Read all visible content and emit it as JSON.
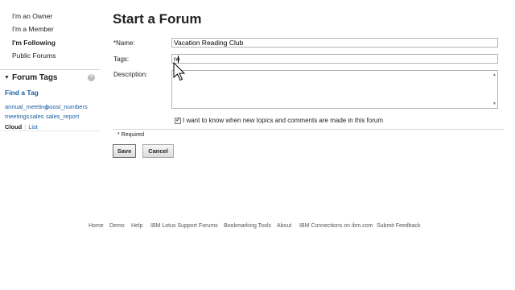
{
  "sidebar": {
    "items": [
      {
        "label": "I'm an Owner"
      },
      {
        "label": "I'm a Member"
      },
      {
        "label": "I'm Following"
      },
      {
        "label": "Public Forums"
      }
    ],
    "tags_title": "Forum Tags",
    "help_symbol": "?",
    "find_tag": "Find a Tag",
    "tags": [
      "annual_meeting",
      "boost_numbers",
      "meetings",
      "sales",
      "sales_report"
    ],
    "cloud_label": "Cloud",
    "list_label": "List"
  },
  "form": {
    "title": "Start a Forum",
    "name_label": "*Name:",
    "name_value": "Vacation Reading Club",
    "tags_label": "Tags:",
    "tags_value": "re",
    "description_label": "Description:",
    "description_value": "",
    "notify_label": "I want to know when new topics and comments are made in this forum",
    "notify_checked": true,
    "required_note": "* Required",
    "save_label": "Save",
    "cancel_label": "Cancel"
  },
  "footer": {
    "links": [
      "Home",
      "Demo",
      "Help",
      "IBM Lotus Support Forums",
      "Bookmarking Tools",
      "About",
      "IBM Connections on ibm.com",
      "Submit Feedback"
    ]
  },
  "colors": {
    "link": "#1a5ea0",
    "text": "#222222",
    "divider": "#cfcfcf"
  }
}
